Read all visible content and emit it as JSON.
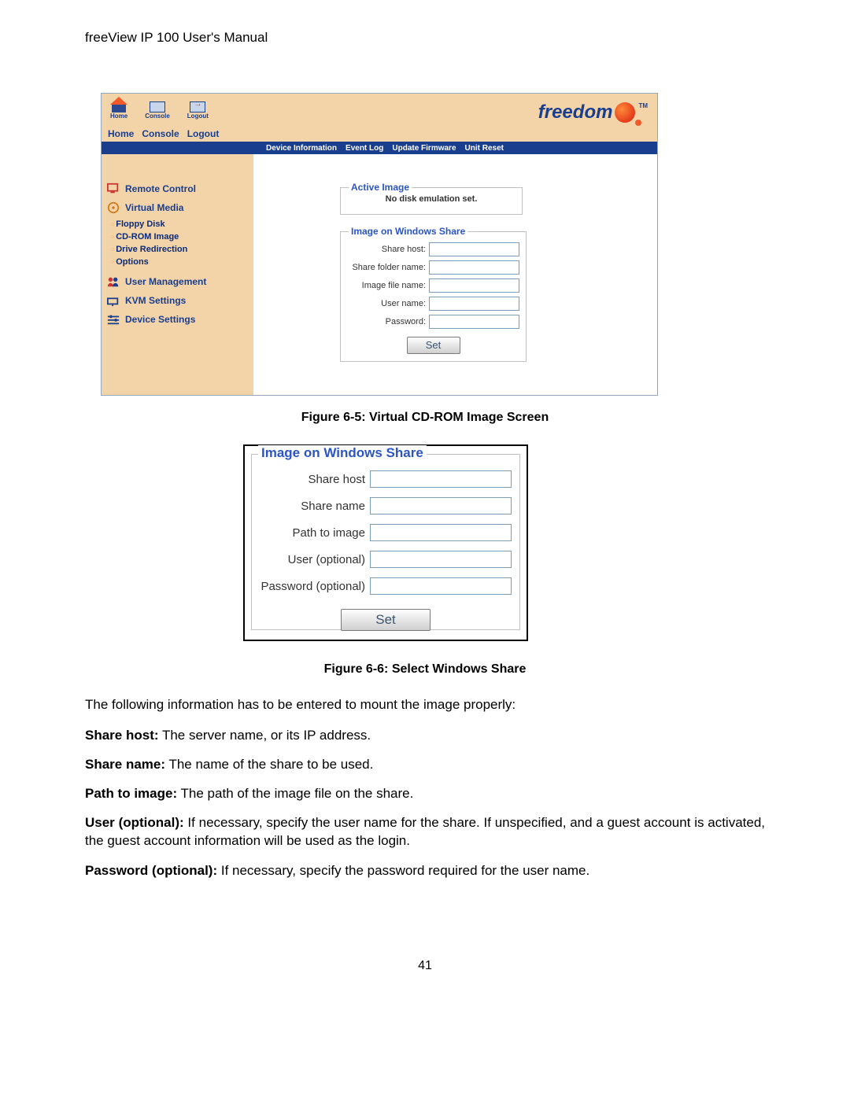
{
  "doc_header": "freeView IP 100 User's Manual",
  "page_number": "41",
  "fig65": {
    "toolbar_labels": {
      "home": "Home",
      "console": "Console",
      "logout": "Logout"
    },
    "toolbar_text": {
      "home": "Home",
      "console": "Console",
      "logout": "Logout"
    },
    "blue_tabs": {
      "device_information": "Device Information",
      "event_log": "Event Log",
      "update_firmware": "Update Firmware",
      "unit_reset": "Unit Reset"
    },
    "brand": "freedom",
    "brand_tm": "TM",
    "sidebar": {
      "remote_control": "Remote Control",
      "virtual_media": "Virtual Media",
      "floppy_disk": "Floppy Disk",
      "cdrom_image": "CD-ROM Image",
      "drive_redirection": "Drive Redirection",
      "options": "Options",
      "user_management": "User Management",
      "kvm_settings": "KVM Settings",
      "device_settings": "Device Settings"
    },
    "active_image": {
      "legend": "Active Image",
      "message": "No disk emulation set."
    },
    "windows_share_small": {
      "legend": "Image on Windows Share",
      "share_host": "Share host:",
      "share_folder_name": "Share folder name:",
      "image_file_name": "Image file name:",
      "user_name": "User name:",
      "password": "Password:",
      "set": "Set"
    }
  },
  "caption65": "Figure 6-5: Virtual CD-ROM Image Screen",
  "fig66": {
    "legend": "Image on Windows Share",
    "share_host": "Share host",
    "share_name": "Share name",
    "path_to_image": "Path to image",
    "user_optional": "User (optional)",
    "password_optional": "Password (optional)",
    "set": "Set"
  },
  "caption66": "Figure 6-6: Select Windows Share",
  "paragraphs": {
    "p1": "The following information has to be entered to mount the image properly:",
    "p2_b": "Share host:",
    "p2_r": " The server name, or its IP address.",
    "p3_b": "Share name:",
    "p3_r": " The name of the share to be used.",
    "p4_b": "Path to image:",
    "p4_r": " The path of the image file on the share.",
    "p5_b": "User (optional):",
    "p5_r": " If necessary, specify the user name for the share. If unspecified, and a guest account is activated, the guest account information will be used as the login.",
    "p6_b": "Password (optional):",
    "p6_r": " If necessary, specify the password required for the user name."
  }
}
